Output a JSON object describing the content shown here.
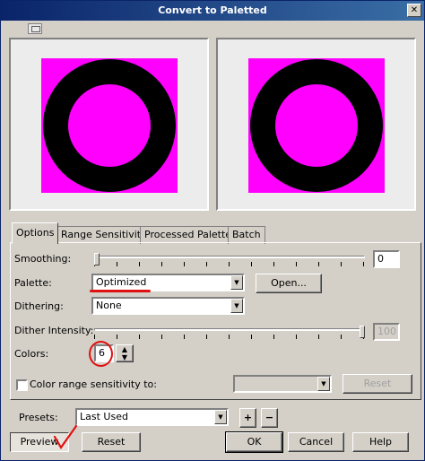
{
  "window": {
    "title": "Convert to Paletted",
    "close_glyph": "✕"
  },
  "tabs": [
    {
      "label": "Options"
    },
    {
      "label": "Range Sensitivity"
    },
    {
      "label": "Processed Palette"
    },
    {
      "label": "Batch"
    }
  ],
  "options": {
    "smoothing_label": "Smoothing:",
    "smoothing_value": "0",
    "palette_label": "Palette:",
    "palette_value": "Optimized",
    "open_button": "Open...",
    "dithering_label": "Dithering:",
    "dithering_value": "None",
    "dither_intensity_label": "Dither Intensity:",
    "dither_intensity_value": "100",
    "colors_label": "Colors:",
    "colors_value": "6",
    "color_range_label": "Color range sensitivity to:",
    "reset_button": "Reset"
  },
  "presets": {
    "label": "Presets:",
    "value": "Last Used",
    "add": "+",
    "remove": "−"
  },
  "footer": {
    "preview": "Preview",
    "reset": "Reset",
    "ok": "OK",
    "cancel": "Cancel",
    "help": "Help"
  },
  "colors": {
    "magenta": "#ff00ff",
    "black": "#000000",
    "annotation_red": "#e01010"
  },
  "icons": [
    "close-icon",
    "preview-toggle-icon",
    "dropdown-arrow-icon",
    "spinner-icon",
    "add-icon",
    "remove-icon"
  ]
}
